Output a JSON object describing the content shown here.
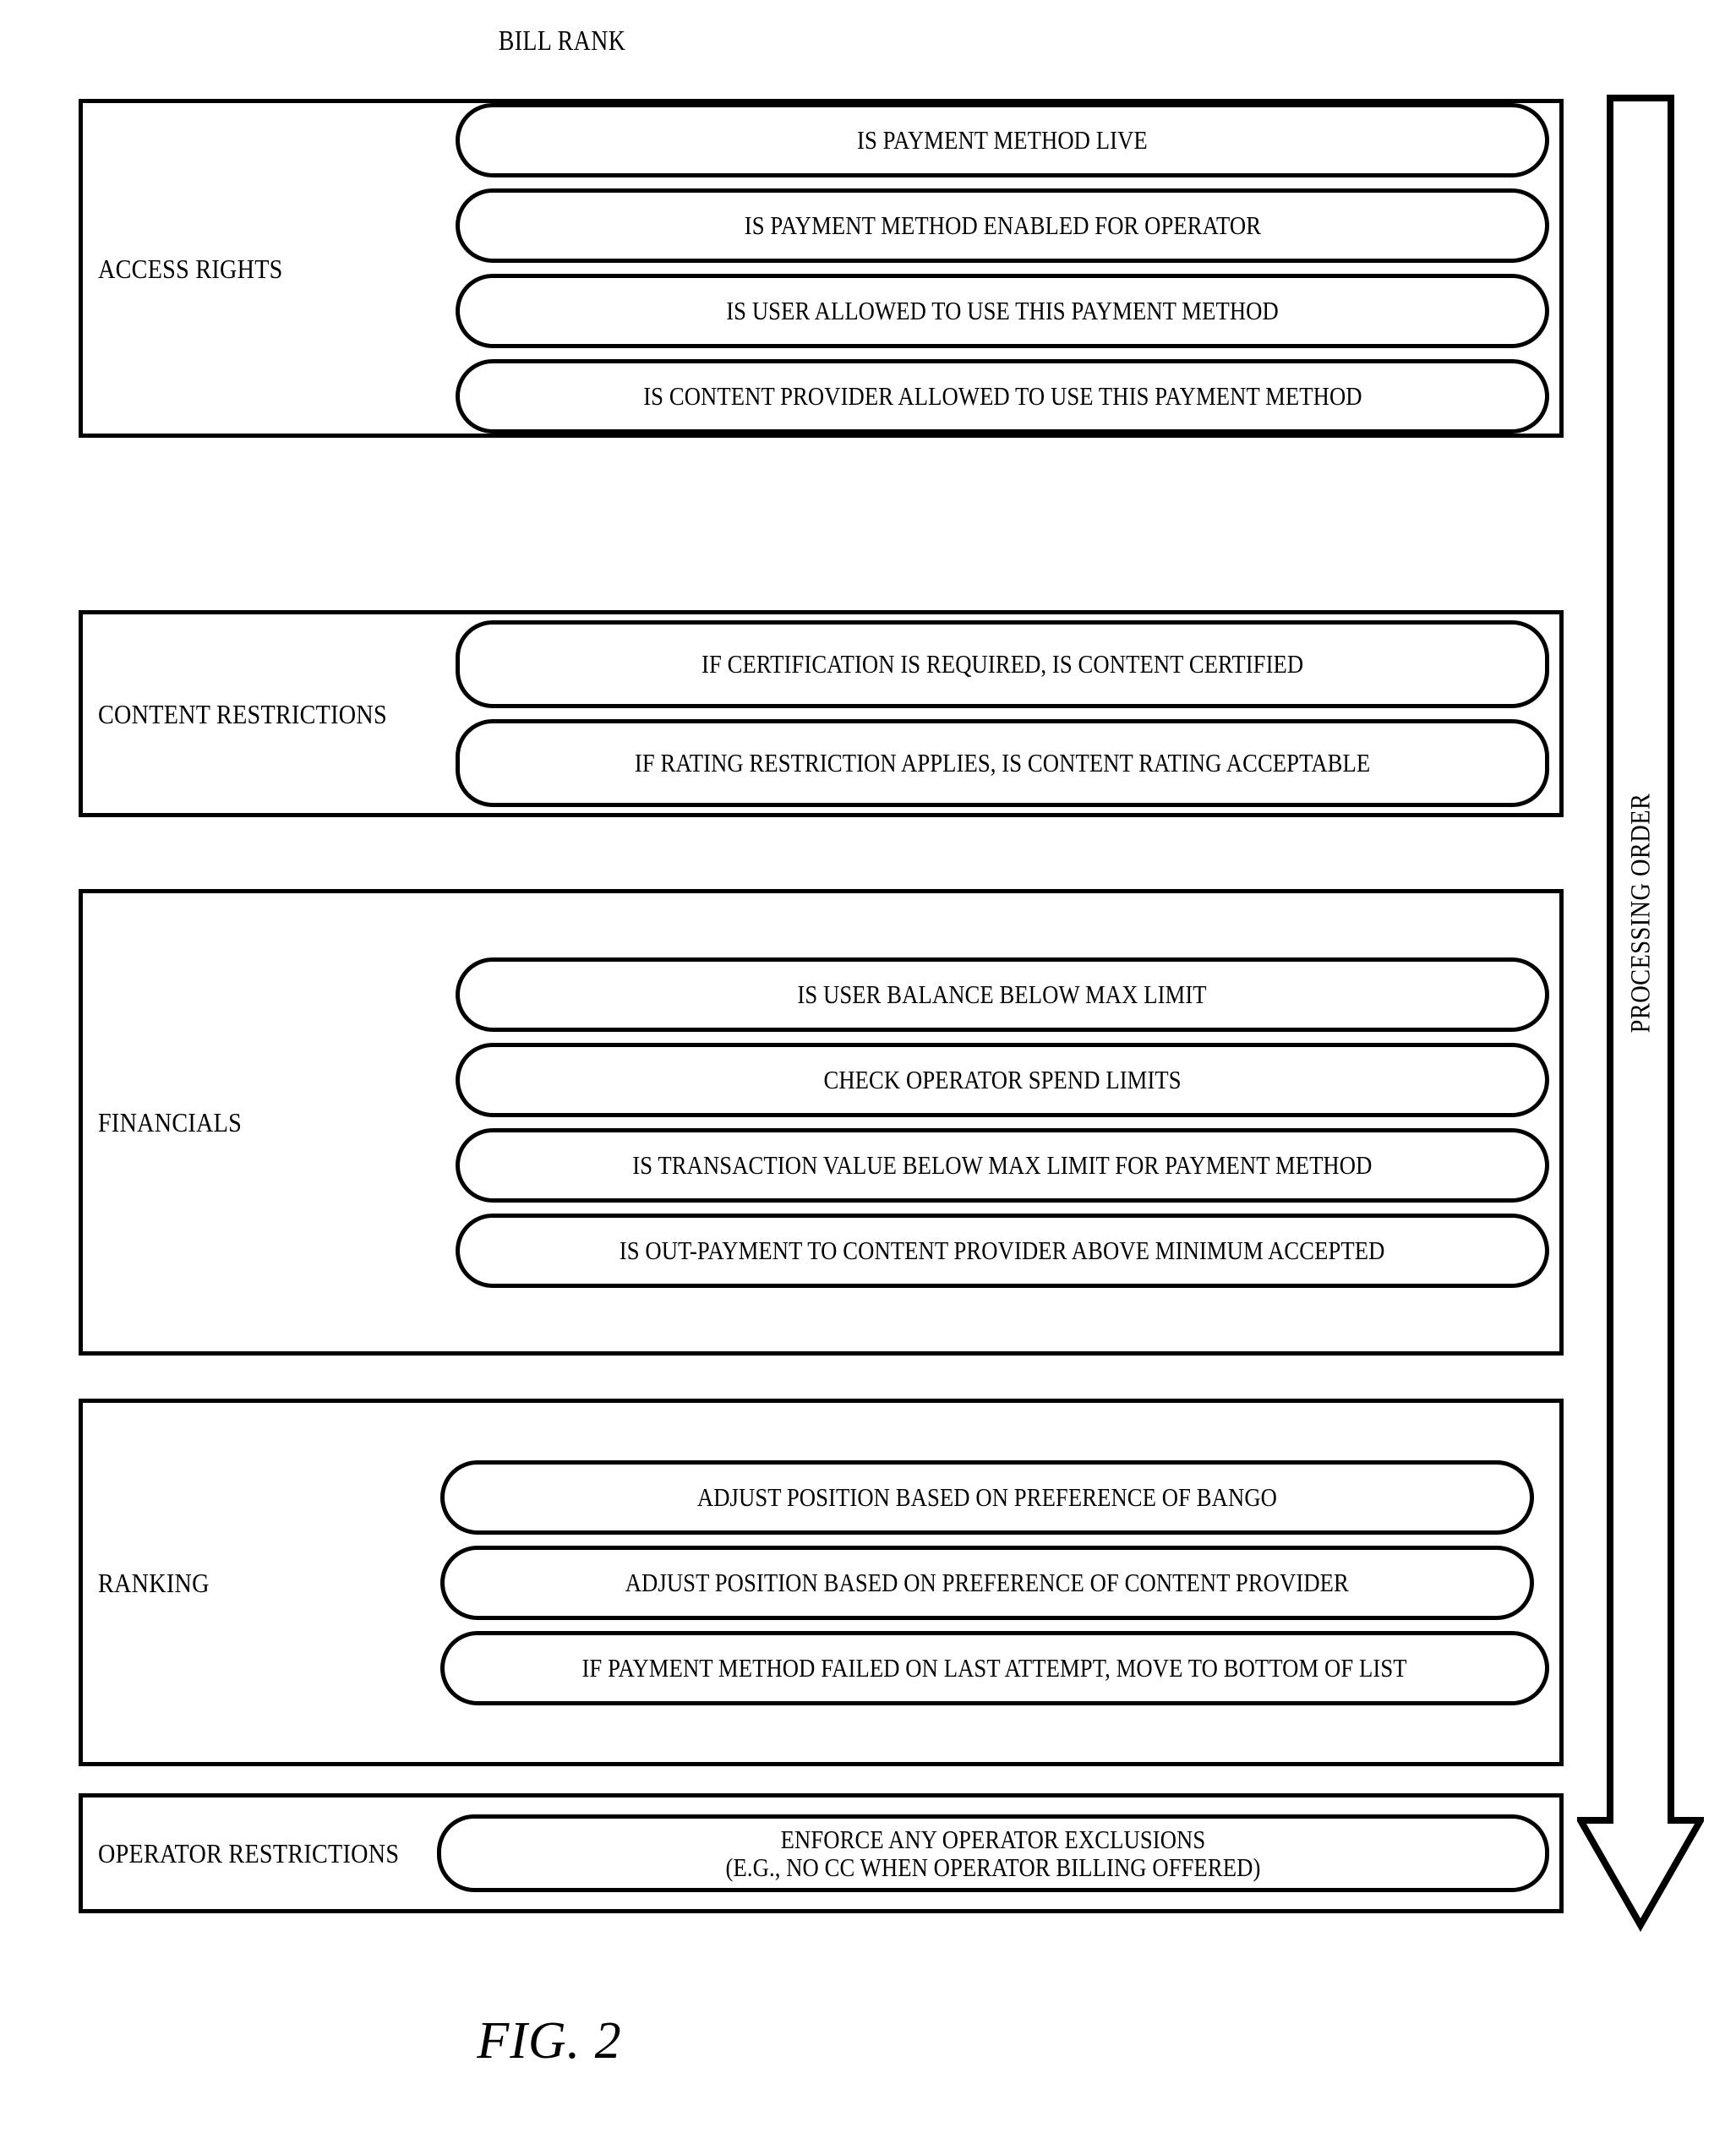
{
  "figure": {
    "title": "BILL RANK",
    "caption": "FIG. 2"
  },
  "arrow": {
    "label": "PROCESSING ORDER",
    "direction": "down"
  },
  "sections": [
    {
      "label": "ACCESS RIGHTS",
      "items": [
        "IS PAYMENT METHOD LIVE",
        "IS PAYMENT METHOD ENABLED FOR OPERATOR",
        "IS USER ALLOWED TO USE THIS PAYMENT METHOD",
        "IS CONTENT PROVIDER ALLOWED TO USE THIS PAYMENT METHOD"
      ]
    },
    {
      "label": "CONTENT RESTRICTIONS",
      "items": [
        "IF CERTIFICATION IS REQUIRED, IS CONTENT CERTIFIED",
        "IF RATING RESTRICTION APPLIES, IS CONTENT RATING ACCEPTABLE"
      ]
    },
    {
      "label": "FINANCIALS",
      "items": [
        "IS USER BALANCE BELOW MAX LIMIT",
        "CHECK OPERATOR SPEND LIMITS",
        "IS TRANSACTION VALUE BELOW MAX LIMIT FOR PAYMENT METHOD",
        "IS OUT-PAYMENT TO CONTENT PROVIDER ABOVE MINIMUM ACCEPTED"
      ]
    },
    {
      "label": "RANKING",
      "items": [
        "ADJUST POSITION BASED ON PREFERENCE OF BANGO",
        "ADJUST POSITION BASED ON PREFERENCE OF CONTENT PROVIDER",
        "IF PAYMENT METHOD FAILED ON LAST ATTEMPT, MOVE TO BOTTOM OF LIST"
      ]
    },
    {
      "label": "OPERATOR RESTRICTIONS",
      "items": [
        "ENFORCE ANY OPERATOR EXCLUSIONS\n(E.G., NO CC WHEN OPERATOR BILLING OFFERED)"
      ]
    }
  ],
  "colors": {
    "line": "#000000",
    "background": "#ffffff"
  }
}
